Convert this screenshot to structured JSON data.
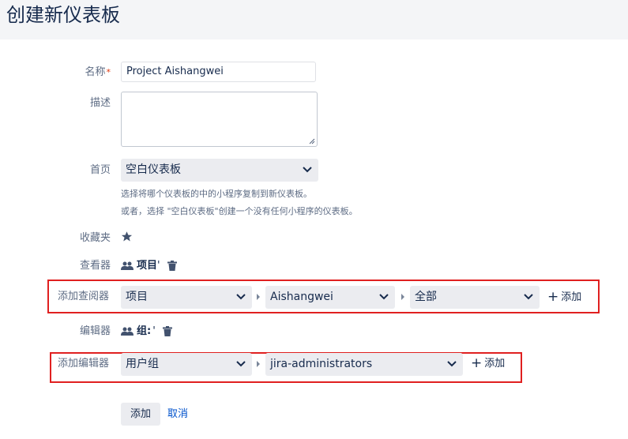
{
  "page": {
    "title": "创建新仪表板"
  },
  "form": {
    "name": {
      "label": "名称",
      "required_mark": "*",
      "value": "Project Aishangwei"
    },
    "description": {
      "label": "描述",
      "value": ""
    },
    "start_from": {
      "label": "首页",
      "value": "空白仪表板",
      "help_line1": "选择将哪个仪表板的中的小程序复制到新仪表板。",
      "help_line2": "或者，选择 \"空白仪表板\"创建一个没有任何小程序的仪表板。"
    },
    "favourite": {
      "label": "收藏夹",
      "icon": "star-icon"
    },
    "viewers": {
      "label": "查看器",
      "entry_text": "项目",
      "entry_suffix": "'",
      "entry_icon": "users-icon",
      "remove_icon": "trash-icon"
    },
    "add_viewer": {
      "label": "添加查阅器",
      "type_select": "项目",
      "project_select": "Aishangwei",
      "role_select": "全部",
      "add_label": "添加"
    },
    "editors": {
      "label": "编辑器",
      "entry_text": "组:",
      "entry_suffix": "'",
      "entry_icon": "users-icon",
      "remove_icon": "trash-icon"
    },
    "add_editor": {
      "label": "添加编辑器",
      "type_select": "用户组",
      "group_select": "jira-administrators",
      "add_label": "添加"
    },
    "actions": {
      "submit_label": "添加",
      "cancel_label": "取消"
    }
  },
  "colors": {
    "link": "#0052cc",
    "highlight_border": "#e02020",
    "required": "#de350b"
  }
}
